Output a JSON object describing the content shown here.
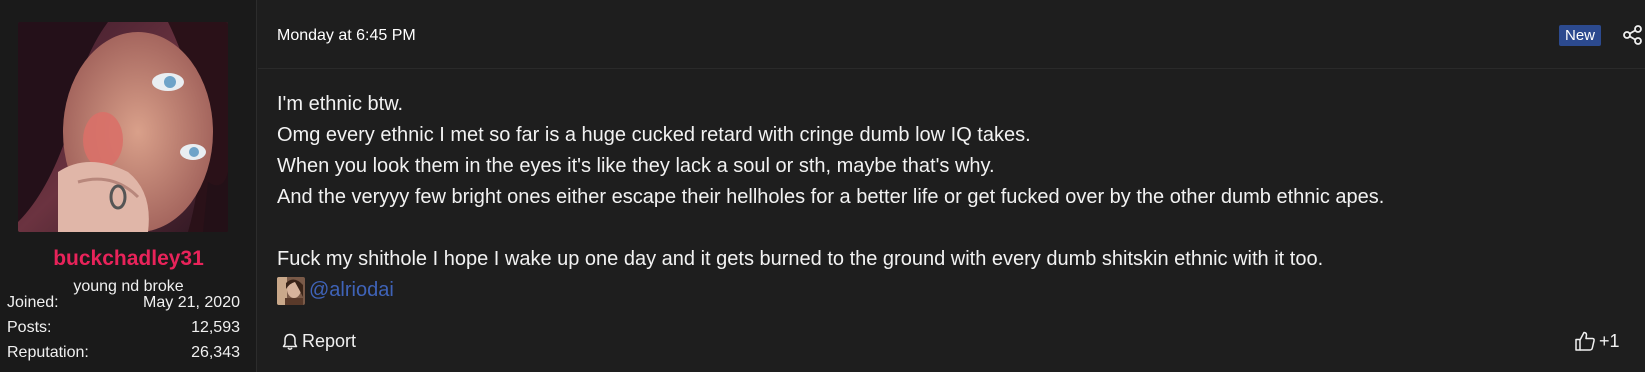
{
  "colors": {
    "username": "#e8235a",
    "mention": "#3f63b8",
    "badge_bg": "#2c4a8f",
    "background": "#1e1e1e"
  },
  "user": {
    "avatar_icon": "user-photo-icon",
    "name": "buckchadley31",
    "title": "young nd broke",
    "stats": [
      {
        "label": "Joined:",
        "value": "May 21, 2020"
      },
      {
        "label": "Posts:",
        "value": "12,593"
      },
      {
        "label": "Reputation:",
        "value": "26,343"
      }
    ]
  },
  "post": {
    "timestamp": "Monday at 6:45 PM",
    "badge": "New",
    "share_icon": "share-icon",
    "lines": [
      "I'm ethnic btw.",
      "Omg every ethnic I met so far is a huge cucked retard with cringe dumb low IQ takes.",
      "When you look them in the eyes it's like they lack a soul or sth, maybe that's why.",
      "And the veryyy few bright ones either escape their hellholes for a better life or get fucked over by the other dumb ethnic apes."
    ],
    "second_paragraph": "Fuck my shithole I hope I wake up one day and it gets burned to the ground with every dumb shitskin ethnic with it too.",
    "mention": "@alriodai"
  },
  "footer": {
    "report_label": "Report",
    "report_icon": "bell-icon",
    "like_label": "+1",
    "like_icon": "thumbs-up-icon"
  }
}
